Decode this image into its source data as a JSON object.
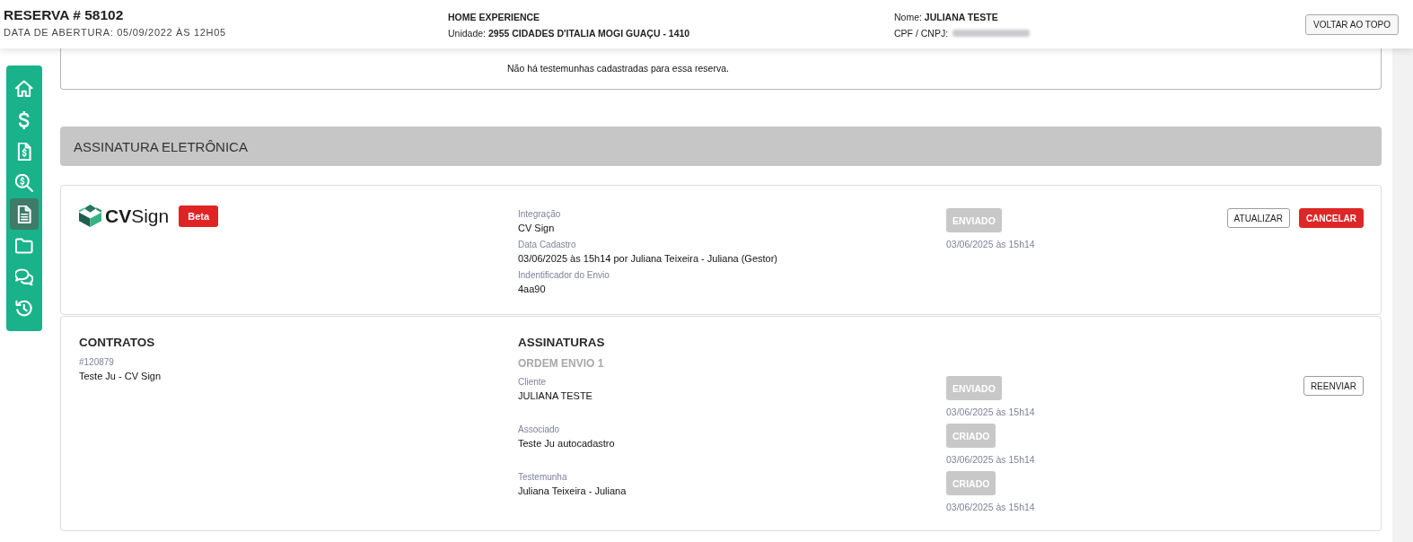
{
  "header": {
    "title": "RESERVA # 58102",
    "opened": "DATA DE ABERTURA: 05/09/2022 ÀS 12H05",
    "project": "HOME EXPERIENCE",
    "unit": "Unidade: **2955 CIDADES D'ITALIA MOGI GUAÇU - 1410**",
    "client_name": "Nome: **JULIANA TESTE**",
    "document_label": "CPF / CNPJ:",
    "document_redacted": true,
    "button": "VOLTAR AO TOPO"
  },
  "sidebar": {
    "items": [
      {
        "kind": "home",
        "selected": false
      },
      {
        "kind": "dollar",
        "selected": false
      },
      {
        "kind": "invoice",
        "selected": false
      },
      {
        "kind": "search",
        "selected": false
      },
      {
        "kind": "document",
        "selected": true
      },
      {
        "kind": "folder",
        "selected": false
      },
      {
        "kind": "chat",
        "selected": false
      },
      {
        "kind": "history",
        "selected": false
      }
    ]
  },
  "witnesses": {
    "empty_message": "Não há testemunhas cadastradas para essa reserva."
  },
  "section": {
    "title": "ASSINATURA ELETRÔNICA"
  },
  "integration": {
    "logo_text": "**CV**Sign",
    "badge": "Beta",
    "fields": [
      {
        "label": "Integração",
        "value": "CV Sign"
      },
      {
        "label": "Data Cadastro",
        "value": "03/06/2025 às 15h14 por Juliana Teixeira - Juliana (Gestor)"
      },
      {
        "label": "Indentificador do Envio",
        "value": "4aa90"
      }
    ],
    "status": "ENVIADO",
    "status_date": "03/06/2025 às 15h14",
    "buttons": [
      {
        "label": "ATUALIZAR",
        "kind": "default"
      },
      {
        "label": "CANCELAR",
        "kind": "danger"
      }
    ]
  },
  "contracts": {
    "title": "CONTRATOS",
    "items": [
      {
        "number": "#120879",
        "name": "Teste Ju - CV Sign"
      }
    ]
  },
  "signatures": {
    "title": "ASSINATURAS",
    "order": "ORDEM ENVIO 1",
    "signers": [
      {
        "role": "Cliente",
        "name": "JULIANA TESTE",
        "status": "ENVIADO",
        "date": "03/06/2025 às 15h14",
        "action": "REENVIAR"
      },
      {
        "role": "Associado",
        "name": "Teste Ju autocadastro",
        "status": "CRIADO",
        "date": "03/06/2025 às 15h14"
      },
      {
        "role": "Testemunha",
        "name": "Juliana Teixeira - Juliana",
        "status": "CRIADO",
        "date": "03/06/2025 às 15h14"
      }
    ]
  }
}
